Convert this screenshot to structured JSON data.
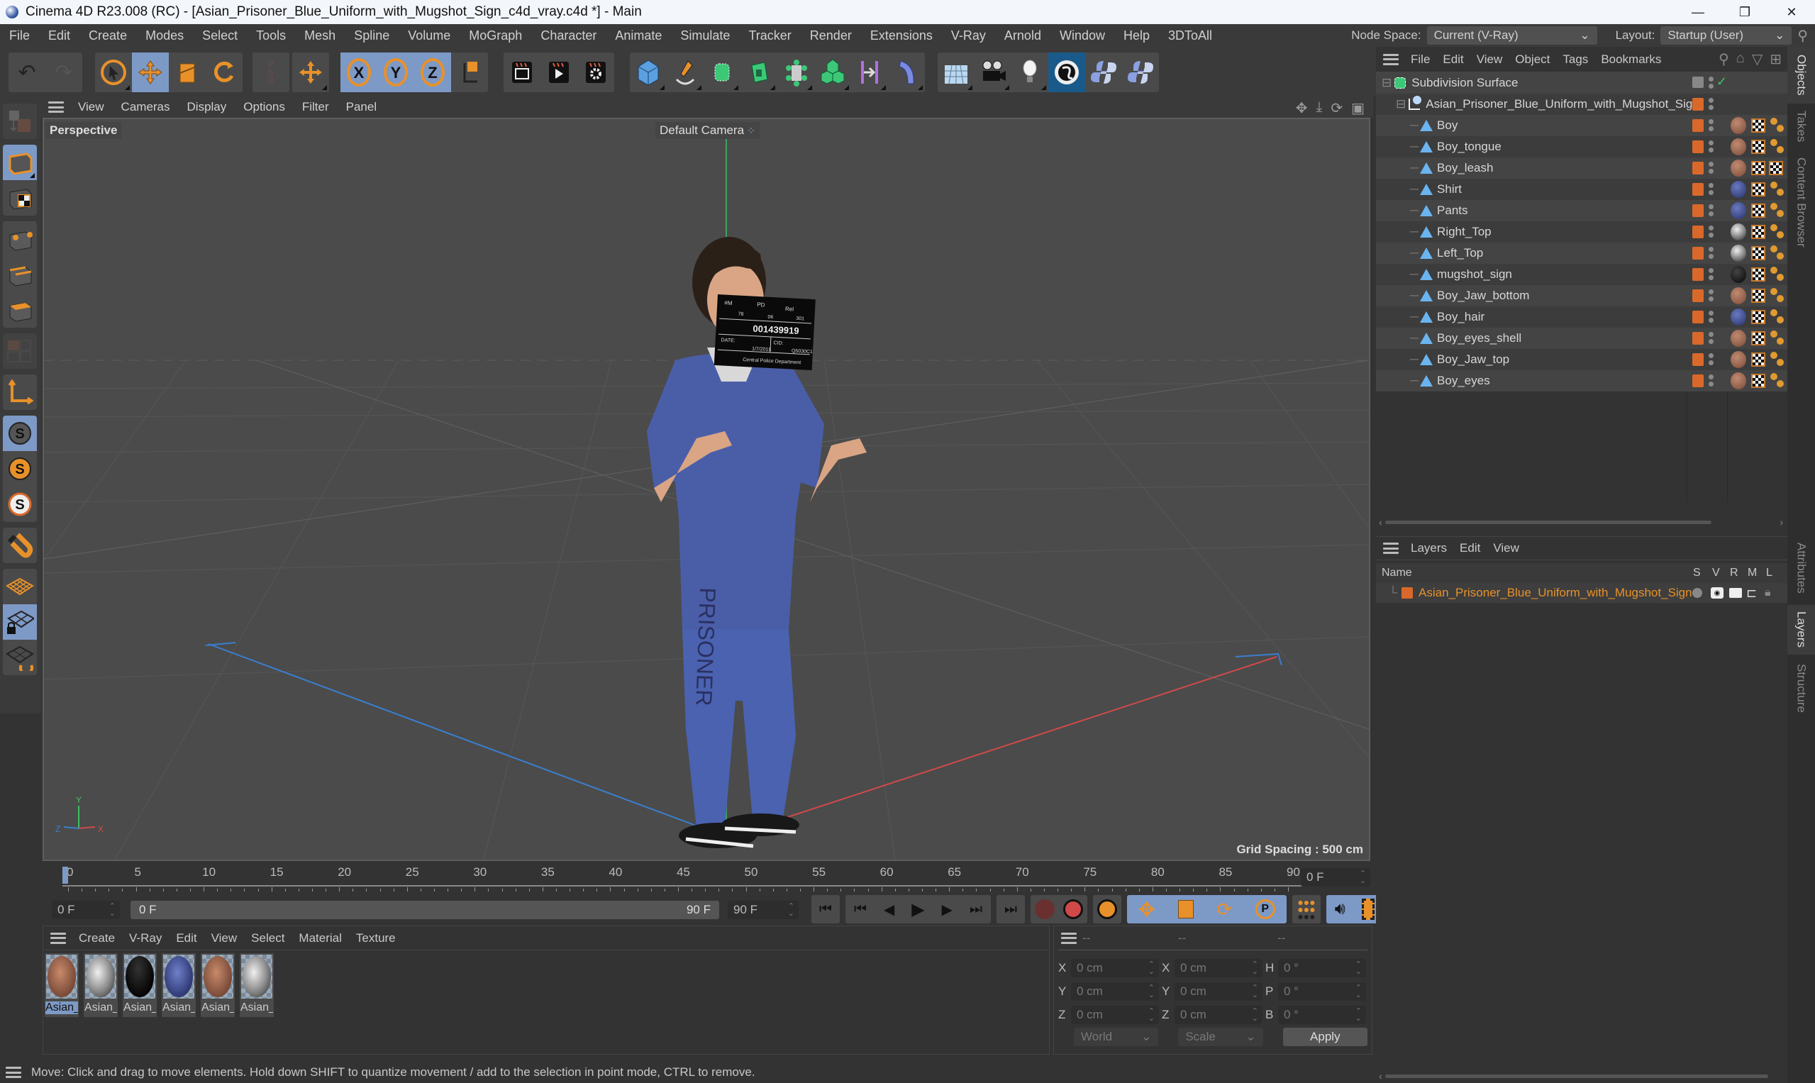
{
  "window": {
    "title": "Cinema 4D R23.008 (RC) - [Asian_Prisoner_Blue_Uniform_with_Mugshot_Sign_c4d_vray.c4d *] - Main",
    "minimize": "—",
    "maximize": "❐",
    "close": "✕"
  },
  "menubar": {
    "items": [
      "File",
      "Edit",
      "Create",
      "Modes",
      "Select",
      "Tools",
      "Mesh",
      "Spline",
      "Volume",
      "MoGraph",
      "Character",
      "Animate",
      "Simulate",
      "Tracker",
      "Render",
      "Extensions",
      "V-Ray",
      "Arnold",
      "Window",
      "Help",
      "3DToAll"
    ],
    "node_space_label": "Node Space:",
    "node_space_value": "Current (V-Ray)",
    "layout_label": "Layout:",
    "layout_value": "Startup (User)"
  },
  "toolbar": {
    "groups": [
      [
        "undo",
        "redo"
      ],
      [
        "live-selection",
        "move",
        "scale",
        "rotate"
      ],
      [
        "psr-lock",
        "recent-tool"
      ],
      [
        "x-axis-lock",
        "y-axis-lock",
        "z-axis-lock",
        "coordinate-system"
      ],
      [
        "render-view",
        "render-picture-viewer",
        "render-settings"
      ],
      [
        "cube",
        "pen",
        "subdivision-surface",
        "extrude",
        "cloner",
        "mograph-fracture",
        "symmetry",
        "deformer"
      ],
      [
        "floor",
        "camera",
        "light",
        "vray-logo",
        "python-1",
        "python-2"
      ]
    ]
  },
  "left_tools": [
    "make-editable",
    "model-mode",
    "texture-mode",
    "points-mode",
    "edges-mode",
    "polygons-mode",
    "uv-mode",
    "axis-mode",
    "snap-disabled",
    "snap-enabled",
    "soft-selection",
    "magnet",
    "workplane",
    "locked-workplane",
    "workplane-align"
  ],
  "viewport": {
    "menu": [
      "View",
      "Cameras",
      "Display",
      "Options",
      "Filter",
      "Panel"
    ],
    "label": "Perspective",
    "camera": "Default Camera",
    "grid_spacing": "Grid Spacing : 500 cm",
    "axis": {
      "x": "X",
      "y": "Y",
      "z": "Z"
    },
    "mugshot": {
      "row1": [
        "#M",
        "PD",
        "Rel"
      ],
      "row2": [
        "78",
        "06",
        "301"
      ],
      "id": "001439919",
      "date_label": "DATE:",
      "date": "1/7/2015",
      "cid_label": "CID:",
      "cid": "Q5030C1",
      "dept": "Central Police Department"
    },
    "pants_text": "PRISONER"
  },
  "timeline": {
    "ticks": [
      "0",
      "5",
      "10",
      "15",
      "20",
      "25",
      "30",
      "35",
      "40",
      "45",
      "50",
      "55",
      "60",
      "65",
      "70",
      "75",
      "80",
      "85",
      "90"
    ],
    "current_frame": "0 F",
    "start_field": "0 F",
    "range_start": "0 F",
    "range_end": "90 F",
    "end_field": "90 F"
  },
  "materials": {
    "menu": [
      "Create",
      "V-Ray",
      "Edit",
      "View",
      "Select",
      "Material",
      "Texture"
    ],
    "items": [
      {
        "label": "Asian_Pr",
        "type": "skin",
        "selected": true
      },
      {
        "label": "Asian_Pr",
        "type": "top"
      },
      {
        "label": "Asian_Pr",
        "type": "sign"
      },
      {
        "label": "Asian_Pr",
        "type": "uniform"
      },
      {
        "label": "Asian_Pr",
        "type": "skin"
      },
      {
        "label": "Asian_Pr",
        "type": "top"
      }
    ]
  },
  "coords": {
    "headers": [
      "--",
      "--",
      "--"
    ],
    "rows": [
      {
        "a": "X",
        "av": "0 cm",
        "b": "X",
        "bv": "0 cm",
        "c": "H",
        "cv": "0 °"
      },
      {
        "a": "Y",
        "av": "0 cm",
        "b": "Y",
        "bv": "0 cm",
        "c": "P",
        "cv": "0 °"
      },
      {
        "a": "Z",
        "av": "0 cm",
        "b": "Z",
        "bv": "0 cm",
        "c": "B",
        "cv": "0 °"
      }
    ],
    "space": "World",
    "mode": "Scale",
    "apply": "Apply"
  },
  "status": "Move: Click and drag to move elements. Hold down SHIFT to quantize movement / add to the selection in point mode, CTRL to remove.",
  "objects": {
    "menu": [
      "File",
      "Edit",
      "View",
      "Object",
      "Tags",
      "Bookmarks"
    ],
    "root": "Subdivision Surface",
    "group": "Asian_Prisoner_Blue_Uniform_with_Mugshot_Sign",
    "children": [
      {
        "name": "Boy",
        "mat": "skin"
      },
      {
        "name": "Boy_tongue",
        "mat": "skin"
      },
      {
        "name": "Boy_leash",
        "mat": "skin"
      },
      {
        "name": "Shirt",
        "mat": "uniform"
      },
      {
        "name": "Pants",
        "mat": "uniform"
      },
      {
        "name": "Right_Top",
        "mat": "top"
      },
      {
        "name": "Left_Top",
        "mat": "top"
      },
      {
        "name": "mugshot_sign",
        "mat": "sign"
      },
      {
        "name": "Boy_Jaw_bottom",
        "mat": "skin"
      },
      {
        "name": "Boy_hair",
        "mat": "uniform"
      },
      {
        "name": "Boy_eyes_shell",
        "mat": "skin"
      },
      {
        "name": "Boy_Jaw_top",
        "mat": "skin"
      },
      {
        "name": "Boy_eyes",
        "mat": "skin"
      }
    ]
  },
  "layers": {
    "menu": [
      "Layers",
      "Edit",
      "View"
    ],
    "columns": {
      "name": "Name",
      "s": "S",
      "v": "V",
      "r": "R",
      "m": "M",
      "l": "L"
    },
    "items": [
      {
        "name": "Asian_Prisoner_Blue_Uniform_with_Mugshot_Sign",
        "color": "#d9692a"
      }
    ]
  },
  "side_tabs": {
    "top": [
      "Objects",
      "Takes",
      "Content Browser"
    ],
    "bottom": [
      "Attributes",
      "Layers",
      "Structure"
    ]
  },
  "colors": {
    "accent": "#7d99c6",
    "orange": "#e8912a",
    "layer_text": "#e8912a",
    "axis_x": "#d04a4a",
    "axis_y": "#3cc060",
    "axis_z": "#3a7fd0"
  }
}
